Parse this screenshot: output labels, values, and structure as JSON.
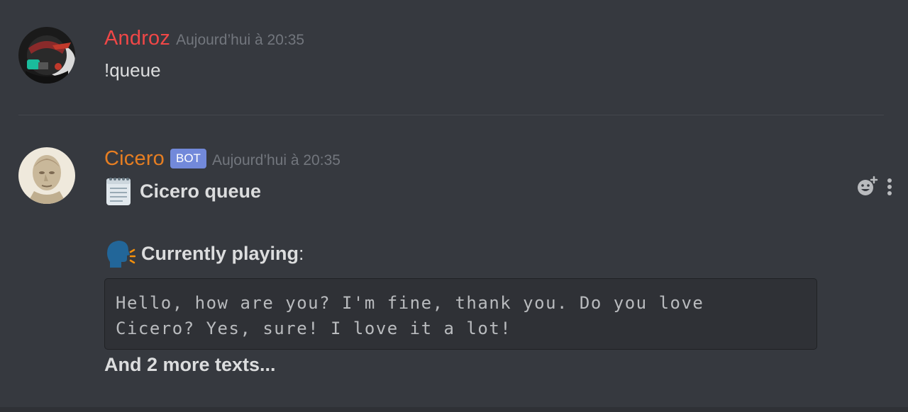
{
  "messages": [
    {
      "author": "Androz",
      "author_color": "#f04747",
      "timestamp": "Aujourd’hui à 20:35",
      "content": "!queue",
      "avatar_icon": "robot-avatar"
    },
    {
      "author": "Cicero",
      "author_color": "#e67e22",
      "bot_tag": "BOT",
      "timestamp": "Aujourd’hui à 20:35",
      "avatar_icon": "cicero-bust-avatar",
      "embed": {
        "title": "Cicero queue",
        "title_icon": "spiral-notepad-icon",
        "playing_label": "Currently playing",
        "playing_colon": ":",
        "playing_icon": "speaking-head-icon",
        "playing_text": "Hello, how are you? I'm fine, thank you. Do you love\nCicero? Yes, sure! I love it a lot!",
        "more": "And 2 more texts..."
      }
    }
  ],
  "actions": [
    "add-reaction-icon",
    "more-options-icon"
  ],
  "colors": {
    "background": "#36393f",
    "bot_tag": "#7289da",
    "timestamp": "#72767d",
    "codeblock_bg": "#2f3136"
  }
}
